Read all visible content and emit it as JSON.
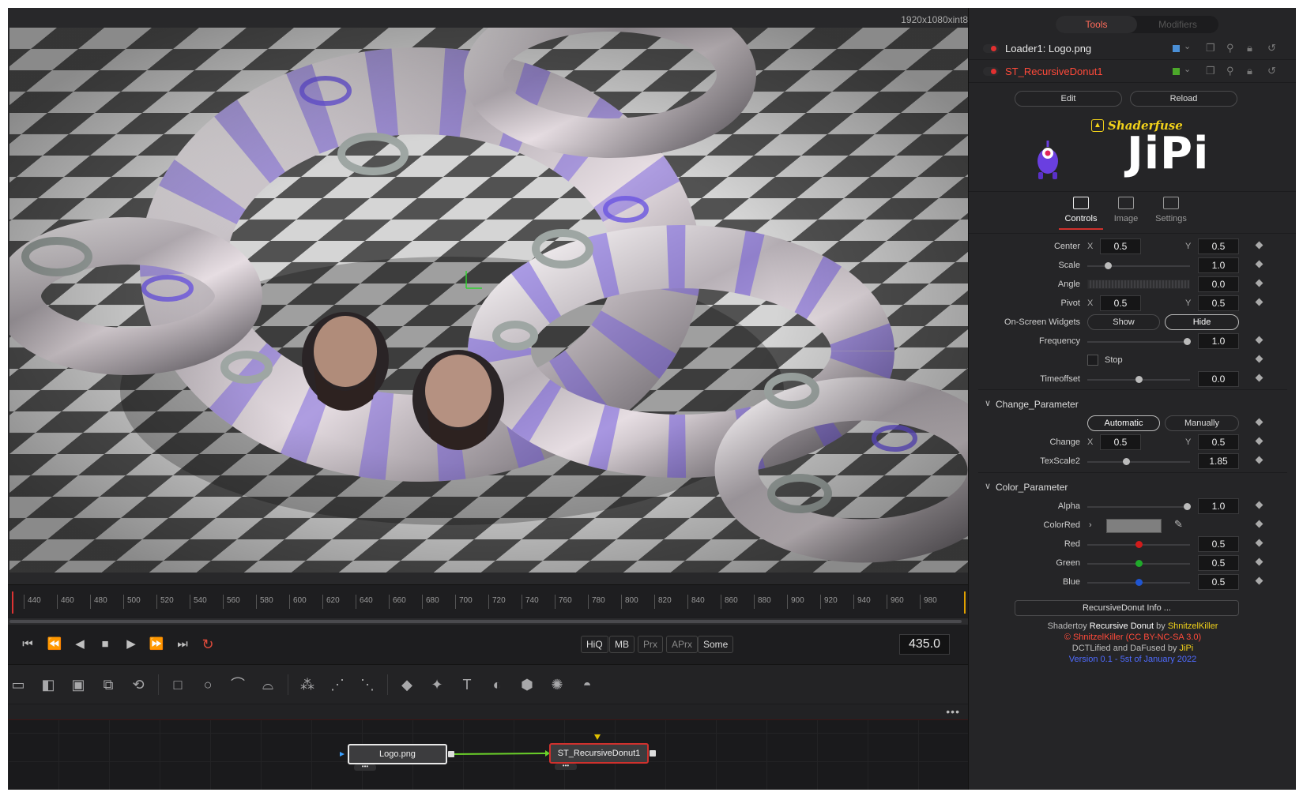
{
  "viewer": {
    "resolution": "1920x1080xint8"
  },
  "timeline": {
    "ticks": [
      "440",
      "460",
      "480",
      "500",
      "520",
      "540",
      "560",
      "580",
      "600",
      "620",
      "640",
      "660",
      "680",
      "700",
      "720",
      "740",
      "760",
      "780",
      "800",
      "820",
      "840",
      "860",
      "880",
      "900",
      "920",
      "940",
      "960",
      "980"
    ],
    "current_frame": "435.0"
  },
  "transport": {
    "quality": [
      "HiQ",
      "MB",
      "Prx",
      "APrx",
      "Some"
    ]
  },
  "flow": {
    "nodes": {
      "loader": "Logo.png",
      "shader": "ST_RecursiveDonut1"
    }
  },
  "inspector": {
    "tabs": {
      "tools": "Tools",
      "modifiers": "Modifiers"
    },
    "tool_rows": [
      {
        "name": "Loader1: Logo.png",
        "color": "#4a8fd6",
        "name_color": "#e8e8e8"
      },
      {
        "name": "ST_RecursiveDonut1",
        "color": "#4ca82a",
        "name_color": "#ff4a3a"
      }
    ],
    "buttons": {
      "edit": "Edit",
      "reload": "Reload"
    },
    "logo": {
      "shaderfuse": "Shaderfuse",
      "author": "JiPi"
    },
    "subtabs": {
      "controls": "Controls",
      "image": "Image",
      "settings": "Settings"
    },
    "params": {
      "center": {
        "label": "Center",
        "x": "0.5",
        "y": "0.5"
      },
      "scale": {
        "label": "Scale",
        "value": "1.0",
        "level": 0.2
      },
      "angle": {
        "label": "Angle",
        "value": "0.0"
      },
      "pivot": {
        "label": "Pivot",
        "x": "0.5",
        "y": "0.5"
      },
      "widgets": {
        "label": "On-Screen Widgets",
        "show": "Show",
        "hide": "Hide"
      },
      "frequency": {
        "label": "Frequency",
        "value": "1.0",
        "level": 0.97
      },
      "stop": {
        "label": "Stop"
      },
      "timeoffset": {
        "label": "Timeoffset",
        "value": "0.0",
        "level": 0.5
      }
    },
    "change_section": {
      "title": "Change_Parameter",
      "automatic": "Automatic",
      "manually": "Manually",
      "change": {
        "label": "Change",
        "x": "0.5",
        "y": "0.5"
      },
      "texscale2": {
        "label": "TexScale2",
        "value": "1.85",
        "level": 0.38
      }
    },
    "color_section": {
      "title": "Color_Parameter",
      "alpha": {
        "label": "Alpha",
        "value": "1.0",
        "level": 0.97
      },
      "colorred": {
        "label": "ColorRed"
      },
      "red": {
        "label": "Red",
        "value": "0.5",
        "level": 0.5,
        "color": "#d11b1b"
      },
      "green": {
        "label": "Green",
        "value": "0.5",
        "level": 0.5,
        "color": "#1faa2a"
      },
      "blue": {
        "label": "Blue",
        "value": "0.5",
        "level": 0.5,
        "color": "#1f55d1"
      }
    },
    "info_button": "RecursiveDonut Info ...",
    "credits": {
      "line1_a": "Shadertoy ",
      "line1_b": "Recursive Donut",
      "line1_c": " by ",
      "line1_d": "ShnitzelKiller",
      "line2": "© ShnitzelKiller (CC BY-NC-SA 3.0)",
      "line3_a": "DCTLified and DaFused by ",
      "line3_b": "JiPi",
      "line4": "Version 0.1 - 5st of January 2022"
    }
  }
}
